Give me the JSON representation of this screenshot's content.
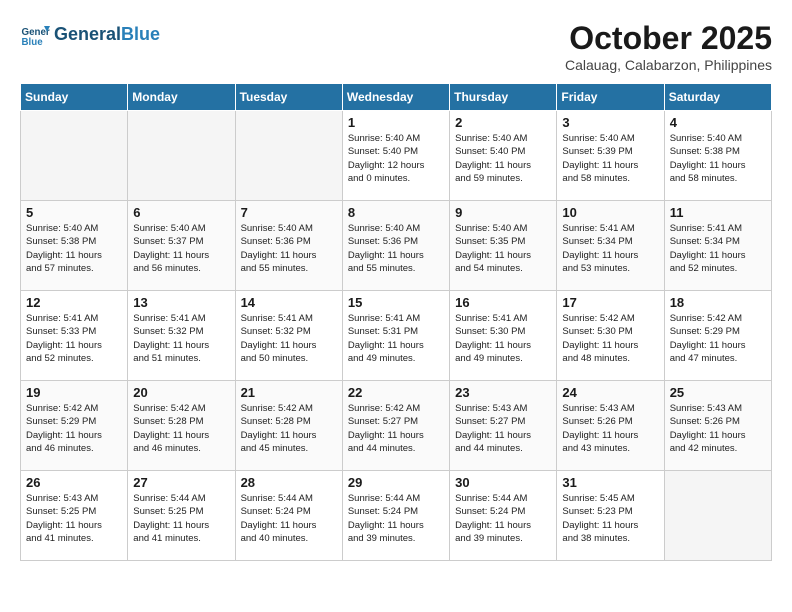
{
  "logo": {
    "line1": "General",
    "line2": "Blue"
  },
  "title": "October 2025",
  "subtitle": "Calauag, Calabarzon, Philippines",
  "days_of_week": [
    "Sunday",
    "Monday",
    "Tuesday",
    "Wednesday",
    "Thursday",
    "Friday",
    "Saturday"
  ],
  "weeks": [
    [
      {
        "num": "",
        "info": ""
      },
      {
        "num": "",
        "info": ""
      },
      {
        "num": "",
        "info": ""
      },
      {
        "num": "1",
        "info": "Sunrise: 5:40 AM\nSunset: 5:40 PM\nDaylight: 12 hours\nand 0 minutes."
      },
      {
        "num": "2",
        "info": "Sunrise: 5:40 AM\nSunset: 5:40 PM\nDaylight: 11 hours\nand 59 minutes."
      },
      {
        "num": "3",
        "info": "Sunrise: 5:40 AM\nSunset: 5:39 PM\nDaylight: 11 hours\nand 58 minutes."
      },
      {
        "num": "4",
        "info": "Sunrise: 5:40 AM\nSunset: 5:38 PM\nDaylight: 11 hours\nand 58 minutes."
      }
    ],
    [
      {
        "num": "5",
        "info": "Sunrise: 5:40 AM\nSunset: 5:38 PM\nDaylight: 11 hours\nand 57 minutes."
      },
      {
        "num": "6",
        "info": "Sunrise: 5:40 AM\nSunset: 5:37 PM\nDaylight: 11 hours\nand 56 minutes."
      },
      {
        "num": "7",
        "info": "Sunrise: 5:40 AM\nSunset: 5:36 PM\nDaylight: 11 hours\nand 55 minutes."
      },
      {
        "num": "8",
        "info": "Sunrise: 5:40 AM\nSunset: 5:36 PM\nDaylight: 11 hours\nand 55 minutes."
      },
      {
        "num": "9",
        "info": "Sunrise: 5:40 AM\nSunset: 5:35 PM\nDaylight: 11 hours\nand 54 minutes."
      },
      {
        "num": "10",
        "info": "Sunrise: 5:41 AM\nSunset: 5:34 PM\nDaylight: 11 hours\nand 53 minutes."
      },
      {
        "num": "11",
        "info": "Sunrise: 5:41 AM\nSunset: 5:34 PM\nDaylight: 11 hours\nand 52 minutes."
      }
    ],
    [
      {
        "num": "12",
        "info": "Sunrise: 5:41 AM\nSunset: 5:33 PM\nDaylight: 11 hours\nand 52 minutes."
      },
      {
        "num": "13",
        "info": "Sunrise: 5:41 AM\nSunset: 5:32 PM\nDaylight: 11 hours\nand 51 minutes."
      },
      {
        "num": "14",
        "info": "Sunrise: 5:41 AM\nSunset: 5:32 PM\nDaylight: 11 hours\nand 50 minutes."
      },
      {
        "num": "15",
        "info": "Sunrise: 5:41 AM\nSunset: 5:31 PM\nDaylight: 11 hours\nand 49 minutes."
      },
      {
        "num": "16",
        "info": "Sunrise: 5:41 AM\nSunset: 5:30 PM\nDaylight: 11 hours\nand 49 minutes."
      },
      {
        "num": "17",
        "info": "Sunrise: 5:42 AM\nSunset: 5:30 PM\nDaylight: 11 hours\nand 48 minutes."
      },
      {
        "num": "18",
        "info": "Sunrise: 5:42 AM\nSunset: 5:29 PM\nDaylight: 11 hours\nand 47 minutes."
      }
    ],
    [
      {
        "num": "19",
        "info": "Sunrise: 5:42 AM\nSunset: 5:29 PM\nDaylight: 11 hours\nand 46 minutes."
      },
      {
        "num": "20",
        "info": "Sunrise: 5:42 AM\nSunset: 5:28 PM\nDaylight: 11 hours\nand 46 minutes."
      },
      {
        "num": "21",
        "info": "Sunrise: 5:42 AM\nSunset: 5:28 PM\nDaylight: 11 hours\nand 45 minutes."
      },
      {
        "num": "22",
        "info": "Sunrise: 5:42 AM\nSunset: 5:27 PM\nDaylight: 11 hours\nand 44 minutes."
      },
      {
        "num": "23",
        "info": "Sunrise: 5:43 AM\nSunset: 5:27 PM\nDaylight: 11 hours\nand 44 minutes."
      },
      {
        "num": "24",
        "info": "Sunrise: 5:43 AM\nSunset: 5:26 PM\nDaylight: 11 hours\nand 43 minutes."
      },
      {
        "num": "25",
        "info": "Sunrise: 5:43 AM\nSunset: 5:26 PM\nDaylight: 11 hours\nand 42 minutes."
      }
    ],
    [
      {
        "num": "26",
        "info": "Sunrise: 5:43 AM\nSunset: 5:25 PM\nDaylight: 11 hours\nand 41 minutes."
      },
      {
        "num": "27",
        "info": "Sunrise: 5:44 AM\nSunset: 5:25 PM\nDaylight: 11 hours\nand 41 minutes."
      },
      {
        "num": "28",
        "info": "Sunrise: 5:44 AM\nSunset: 5:24 PM\nDaylight: 11 hours\nand 40 minutes."
      },
      {
        "num": "29",
        "info": "Sunrise: 5:44 AM\nSunset: 5:24 PM\nDaylight: 11 hours\nand 39 minutes."
      },
      {
        "num": "30",
        "info": "Sunrise: 5:44 AM\nSunset: 5:24 PM\nDaylight: 11 hours\nand 39 minutes."
      },
      {
        "num": "31",
        "info": "Sunrise: 5:45 AM\nSunset: 5:23 PM\nDaylight: 11 hours\nand 38 minutes."
      },
      {
        "num": "",
        "info": ""
      }
    ]
  ]
}
